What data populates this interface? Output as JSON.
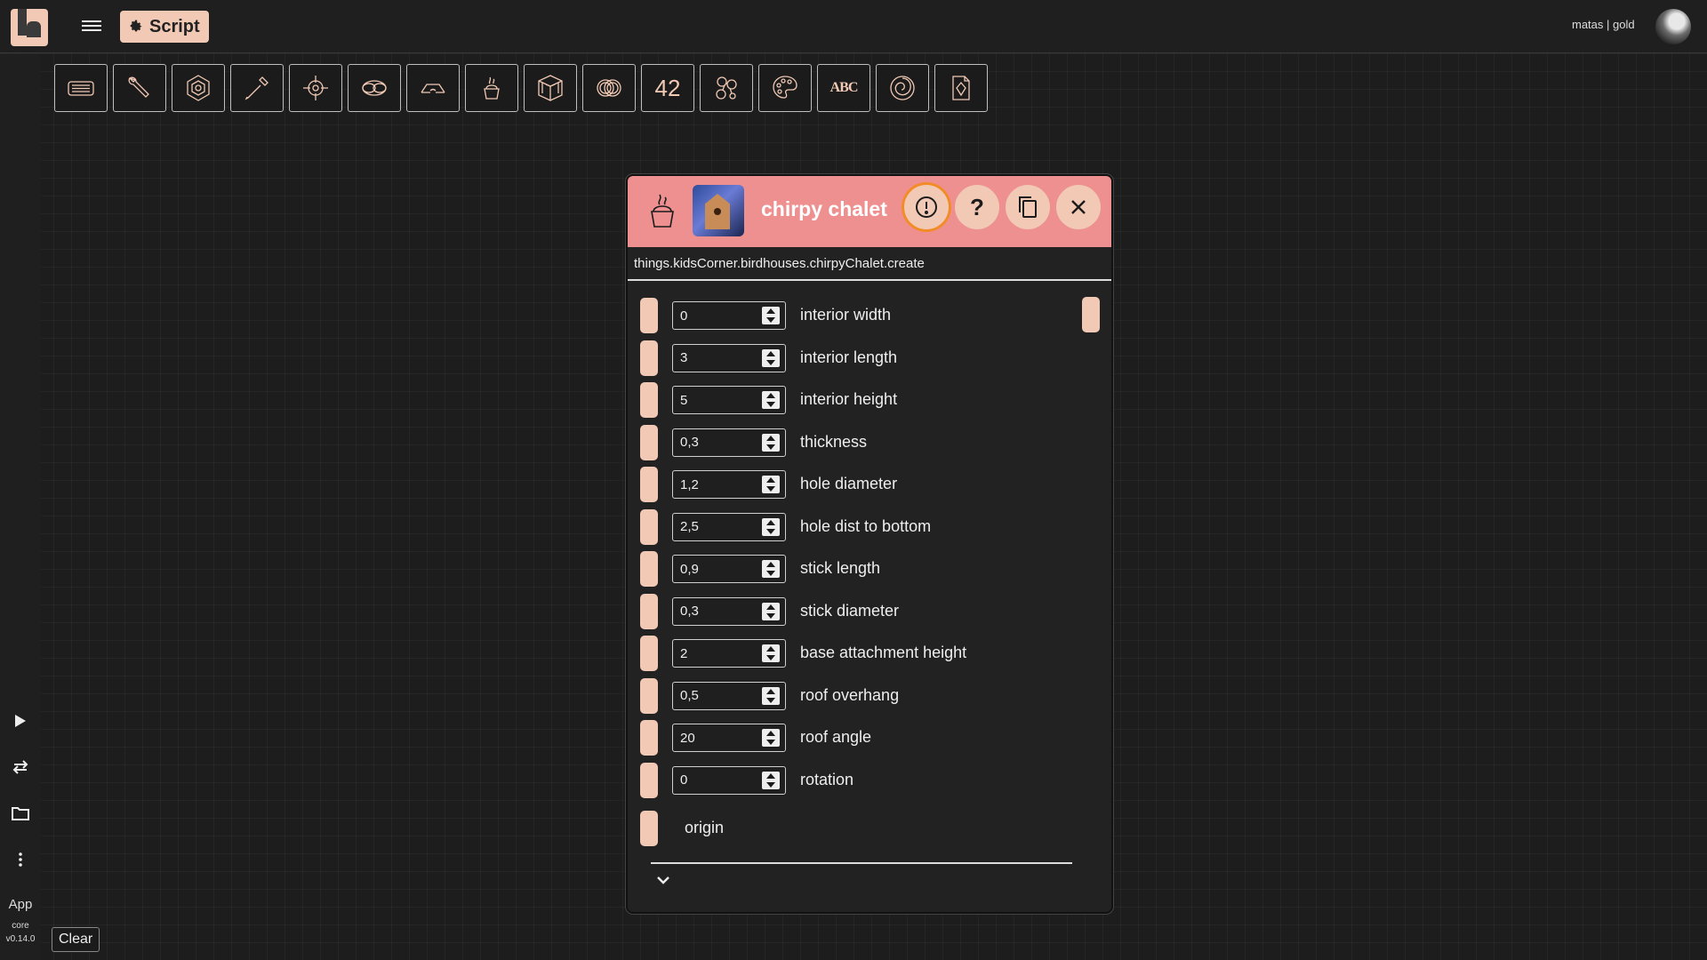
{
  "topbar": {
    "script_label": "Script",
    "user": "matas | gold"
  },
  "toolbar": {
    "tools": [
      {
        "name": "keyboard-tool"
      },
      {
        "name": "wrench-tool"
      },
      {
        "name": "hex-nut-tool"
      },
      {
        "name": "pipette-tool"
      },
      {
        "name": "target-tool"
      },
      {
        "name": "infinity-tool"
      },
      {
        "name": "glasses-tool"
      },
      {
        "name": "cup-tool"
      },
      {
        "name": "cube-tool"
      },
      {
        "name": "rings-tool"
      },
      {
        "name": "number-tool",
        "text": "42"
      },
      {
        "name": "molecule-tool"
      },
      {
        "name": "palette-tool"
      },
      {
        "name": "text-tool",
        "text": "ABC"
      },
      {
        "name": "spiral-tool"
      },
      {
        "name": "file-tool"
      }
    ]
  },
  "leftrail": {
    "app_label": "App",
    "core_label": "core",
    "version": "v0.14.0",
    "clear_label": "Clear"
  },
  "panel": {
    "title": "chirpy chalet",
    "path": "things.kidsCorner.birdhouses.chirpyChalet.create",
    "header_buttons": [
      "warning",
      "help",
      "copy",
      "close"
    ],
    "rows": [
      {
        "value": "0",
        "label": "interior width"
      },
      {
        "value": "3",
        "label": "interior length"
      },
      {
        "value": "5",
        "label": "interior height"
      },
      {
        "value": "0,3",
        "label": "thickness"
      },
      {
        "value": "1,2",
        "label": "hole diameter"
      },
      {
        "value": "2,5",
        "label": "hole dist to bottom"
      },
      {
        "value": "0,9",
        "label": "stick length"
      },
      {
        "value": "0,3",
        "label": "stick diameter"
      },
      {
        "value": "2",
        "label": "base attachment height"
      },
      {
        "value": "0,5",
        "label": "roof overhang"
      },
      {
        "value": "20",
        "label": "roof angle"
      },
      {
        "value": "0",
        "label": "rotation"
      }
    ],
    "origin_label": "origin"
  },
  "colors": {
    "accent": "#f1c9b4",
    "header": "#ee9090",
    "warning_ring": "#f28c28"
  }
}
